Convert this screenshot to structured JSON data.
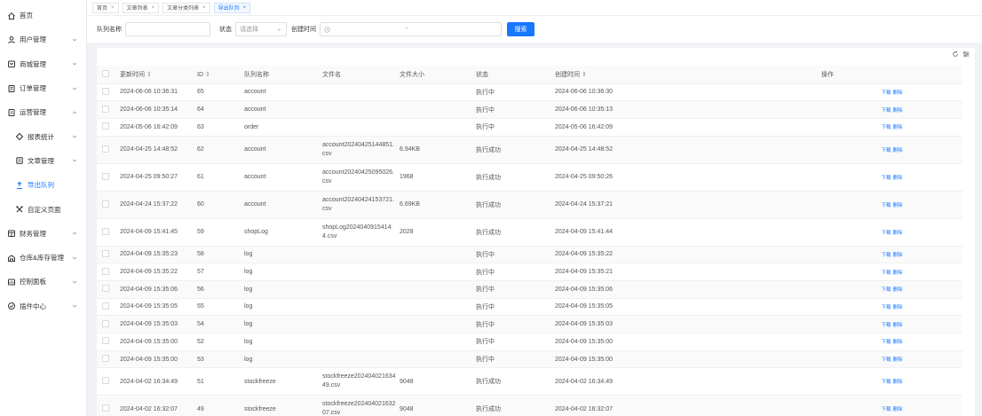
{
  "sidebar": {
    "items": [
      {
        "label": "首页",
        "icon": "home-icon",
        "chevron": false
      },
      {
        "label": "用户管理",
        "icon": "user-icon",
        "chevron": "down"
      },
      {
        "label": "商城管理",
        "icon": "shop-icon",
        "chevron": "down"
      },
      {
        "label": "订单管理",
        "icon": "order-icon",
        "chevron": "down"
      },
      {
        "label": "运营管理",
        "icon": "operation-icon",
        "chevron": "up"
      },
      {
        "label": "报表统计",
        "icon": "report-icon",
        "chevron": "down",
        "sub": true
      },
      {
        "label": "文章管理",
        "icon": "article-icon",
        "chevron": "down",
        "sub": true
      },
      {
        "label": "导出队列",
        "icon": "export-icon",
        "chevron": false,
        "sub": true,
        "active": true
      },
      {
        "label": "自定义页面",
        "icon": "custom-page-icon",
        "chevron": false,
        "sub": true
      },
      {
        "label": "财务管理",
        "icon": "finance-icon",
        "chevron": "down"
      },
      {
        "label": "仓库&库存管理",
        "icon": "warehouse-icon",
        "chevron": "down"
      },
      {
        "label": "控制面板",
        "icon": "dashboard-icon",
        "chevron": "down"
      },
      {
        "label": "插件中心",
        "icon": "plugin-icon",
        "chevron": "down"
      }
    ]
  },
  "tabs": [
    {
      "label": "首页",
      "active": false
    },
    {
      "label": "文章列表",
      "active": false
    },
    {
      "label": "文章分类列表",
      "active": false
    },
    {
      "label": "导出队列",
      "active": true
    }
  ],
  "filter": {
    "queue_label": "队列名称",
    "queue_value": "",
    "status_label": "状态",
    "status_placeholder": "请选择",
    "created_label": "创建时间",
    "date_separator": "-",
    "search_button": "搜索"
  },
  "table": {
    "headers": {
      "updated": "更新时间",
      "id": "ID",
      "queue": "队列名称",
      "filename": "文件名",
      "filesize": "文件大小",
      "status": "状态",
      "created": "创建时间",
      "actions": "操作"
    },
    "action_labels": {
      "download": "下载",
      "delete": "删除"
    },
    "rows": [
      {
        "updated": "2024-06-06 10:36:31",
        "id": "65",
        "queue": "account",
        "filename": "",
        "filesize": "",
        "status": "执行中",
        "created": "2024-06-06 10:36:30"
      },
      {
        "updated": "2024-06-06 10:35:14",
        "id": "64",
        "queue": "account",
        "filename": "",
        "filesize": "",
        "status": "执行中",
        "created": "2024-06-06 10:35:13"
      },
      {
        "updated": "2024-05-06 16:42:09",
        "id": "63",
        "queue": "order",
        "filename": "",
        "filesize": "",
        "status": "执行中",
        "created": "2024-05-06 16:42:09"
      },
      {
        "updated": "2024-04-25 14:48:52",
        "id": "62",
        "queue": "account",
        "filename": "account20240425144851.csv",
        "filesize": "6.94KB",
        "status": "执行成功",
        "created": "2024-04-25 14:48:52"
      },
      {
        "updated": "2024-04-25 09:50:27",
        "id": "61",
        "queue": "account",
        "filename": "account20240425095026.csv",
        "filesize": "1968",
        "status": "执行成功",
        "created": "2024-04-25 09:50:26"
      },
      {
        "updated": "2024-04-24 15:37:22",
        "id": "60",
        "queue": "account",
        "filename": "account20240424153721.csv",
        "filesize": "6.69KB",
        "status": "执行成功",
        "created": "2024-04-24 15:37:21"
      },
      {
        "updated": "2024-04-09 15:41:45",
        "id": "59",
        "queue": "shopLog",
        "filename": "shopLog20240409154144.csv",
        "filesize": "2028",
        "status": "执行成功",
        "created": "2024-04-09 15:41:44"
      },
      {
        "updated": "2024-04-09 15:35:23",
        "id": "58",
        "queue": "log",
        "filename": "",
        "filesize": "",
        "status": "执行中",
        "created": "2024-04-09 15:35:22"
      },
      {
        "updated": "2024-04-09 15:35:22",
        "id": "57",
        "queue": "log",
        "filename": "",
        "filesize": "",
        "status": "执行中",
        "created": "2024-04-09 15:35:21"
      },
      {
        "updated": "2024-04-09 15:35:06",
        "id": "56",
        "queue": "log",
        "filename": "",
        "filesize": "",
        "status": "执行中",
        "created": "2024-04-09 15:35:06"
      },
      {
        "updated": "2024-04-09 15:35:05",
        "id": "55",
        "queue": "log",
        "filename": "",
        "filesize": "",
        "status": "执行中",
        "created": "2024-04-09 15:35:05"
      },
      {
        "updated": "2024-04-09 15:35:03",
        "id": "54",
        "queue": "log",
        "filename": "",
        "filesize": "",
        "status": "执行中",
        "created": "2024-04-09 15:35:03"
      },
      {
        "updated": "2024-04-09 15:35:00",
        "id": "52",
        "queue": "log",
        "filename": "",
        "filesize": "",
        "status": "执行中",
        "created": "2024-04-09 15:35:00"
      },
      {
        "updated": "2024-04-09 15:35:00",
        "id": "53",
        "queue": "log",
        "filename": "",
        "filesize": "",
        "status": "执行中",
        "created": "2024-04-09 15:35:00"
      },
      {
        "updated": "2024-04-02 16:34:49",
        "id": "51",
        "queue": "stockfreeze",
        "filename": "stockfreeze20240402163449.csv",
        "filesize": "9048",
        "status": "执行成功",
        "created": "2024-04-02 16:34:49"
      },
      {
        "updated": "2024-04-02 16:32:07",
        "id": "49",
        "queue": "stockfreeze",
        "filename": "stockfreeze20240402163207.csv",
        "filesize": "9048",
        "status": "执行成功",
        "created": "2024-04-02 16:32:07"
      }
    ]
  },
  "colors": {
    "accent": "#1677ff",
    "text": "#333333",
    "muted": "#999999",
    "bg": "#f0f2f5"
  }
}
